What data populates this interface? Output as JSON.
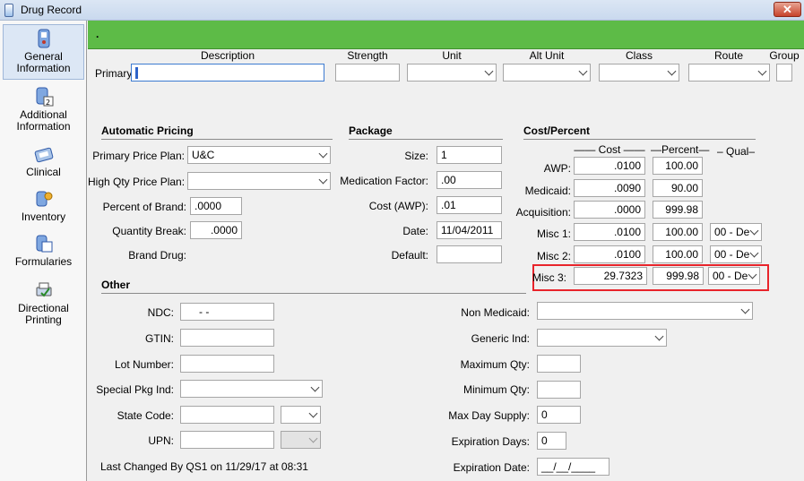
{
  "window": {
    "title": "Drug Record",
    "close_glyph": "✕"
  },
  "sidebar": {
    "items": [
      {
        "label_1": "General",
        "label_2": "Information",
        "icon": "general-info-icon"
      },
      {
        "label_1": "Additional",
        "label_2": "Information",
        "icon": "additional-info-icon"
      },
      {
        "label_1": "Clinical",
        "label_2": "",
        "icon": "clinical-icon"
      },
      {
        "label_1": "Inventory",
        "label_2": "",
        "icon": "inventory-icon"
      },
      {
        "label_1": "Formularies",
        "label_2": "",
        "icon": "formularies-icon"
      },
      {
        "label_1": "Directional",
        "label_2": "Printing",
        "icon": "directional-printing-icon"
      }
    ]
  },
  "header": {
    "green_bar_text": "."
  },
  "primary": {
    "row_label": "Primary",
    "columns": {
      "description": "Description",
      "strength": "Strength",
      "unit": "Unit",
      "alt_unit": "Alt Unit",
      "class": "Class",
      "route": "Route",
      "group": "Group"
    },
    "values": {
      "description": "",
      "strength": "",
      "unit": "",
      "alt_unit": "",
      "class": "",
      "route": "",
      "group": ""
    }
  },
  "automatic_pricing": {
    "title": "Automatic Pricing",
    "primary_price_plan": {
      "label": "Primary Price Plan:",
      "value": "U&C"
    },
    "high_qty_price_plan": {
      "label": "High Qty Price Plan:",
      "value": ""
    },
    "percent_of_brand": {
      "label": "Percent of Brand:",
      "value": ".0000"
    },
    "quantity_break": {
      "label": "Quantity Break:",
      "value": ".0000"
    },
    "brand_drug": {
      "label": "Brand Drug:"
    }
  },
  "package": {
    "title": "Package",
    "size": {
      "label": "Size:",
      "value": "1"
    },
    "medication_factor": {
      "label": "Medication Factor:",
      "value": ".00"
    },
    "cost_awp": {
      "label": "Cost (AWP):",
      "value": ".01"
    },
    "date": {
      "label": "Date:",
      "value": "11/04/2011"
    },
    "default": {
      "label": "Default:",
      "value": ""
    }
  },
  "cost_percent": {
    "title": "Cost/Percent",
    "col_cost": "—— Cost ——",
    "col_percent": "—Percent—",
    "col_qual": "– Qual–",
    "rows": [
      {
        "label": "AWP:",
        "cost": ".0100",
        "percent": "100.00",
        "qual": ""
      },
      {
        "label": "Medicaid:",
        "cost": ".0090",
        "percent": "90.00",
        "qual": ""
      },
      {
        "label": "Acquisition:",
        "cost": ".0000",
        "percent": "999.98",
        "qual": ""
      },
      {
        "label": "Misc 1:",
        "cost": ".0100",
        "percent": "100.00",
        "qual": "00 - De"
      },
      {
        "label": "Misc 2:",
        "cost": ".0100",
        "percent": "100.00",
        "qual": "00 - De"
      },
      {
        "label": "Misc 3:",
        "cost": "29.7323",
        "percent": "999.98",
        "qual": "00 - De"
      }
    ],
    "highlight_color": "#e8242b"
  },
  "other": {
    "title": "Other",
    "ndc": {
      "label": "NDC:",
      "value": "-    -"
    },
    "gtin": {
      "label": "GTIN:",
      "value": ""
    },
    "lot_number": {
      "label": "Lot Number:",
      "value": ""
    },
    "special_pkg_ind": {
      "label": "Special Pkg Ind:",
      "value": ""
    },
    "state_code": {
      "label": "State Code:",
      "value": ""
    },
    "upn": {
      "label": "UPN:",
      "value": ""
    },
    "non_medicaid": {
      "label": "Non Medicaid:",
      "value": ""
    },
    "generic_ind": {
      "label": "Generic Ind:",
      "value": ""
    },
    "maximum_qty": {
      "label": "Maximum Qty:",
      "value": ""
    },
    "minimum_qty": {
      "label": "Minimum Qty:",
      "value": ""
    },
    "max_day_supply": {
      "label": "Max Day Supply:",
      "value": "0"
    },
    "expiration_days": {
      "label": "Expiration Days:",
      "value": "0"
    },
    "expiration_date": {
      "label": "Expiration Date:",
      "value": "__/__/____"
    }
  },
  "footer": {
    "last_changed": "Last Changed By QS1 on 11/29/17 at 08:31"
  },
  "colors": {
    "green_bar": "#5dbb47",
    "active_nav": "#dce7f5"
  }
}
